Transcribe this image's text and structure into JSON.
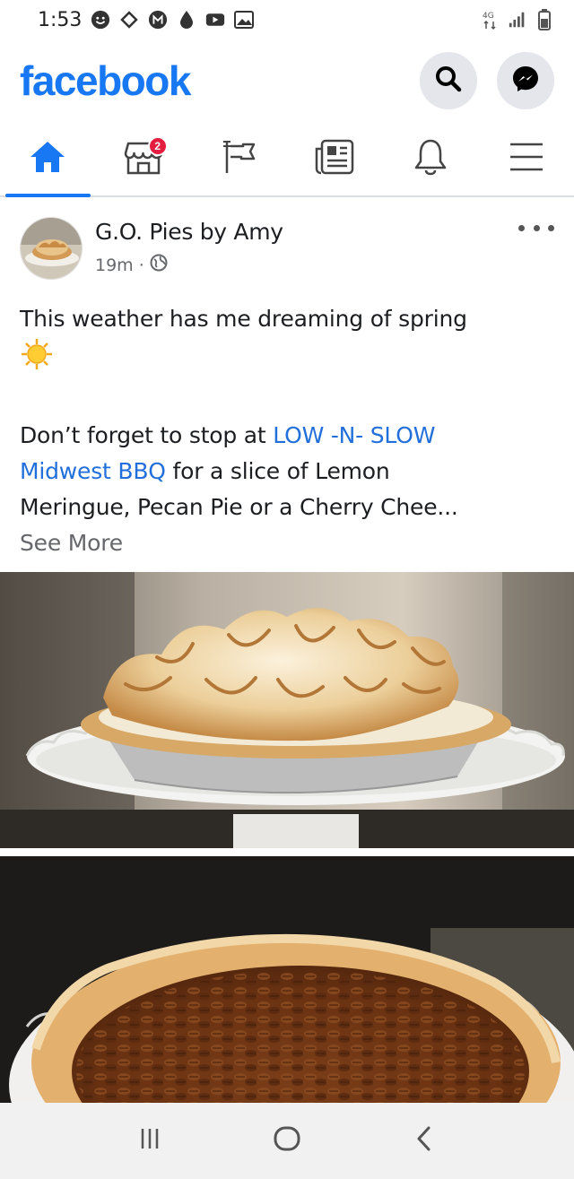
{
  "status_bar": {
    "time": "1:53",
    "left_icons": [
      "smiley-icon",
      "code-diamond-icon",
      "m-app-icon",
      "drop-icon",
      "youtube-icon",
      "image-icon"
    ],
    "right_icons": [
      "4g-icon",
      "signal-icon",
      "battery-icon"
    ]
  },
  "header": {
    "logo": "facebook",
    "brand_color": "#1877f2"
  },
  "nav": {
    "tabs": [
      {
        "name": "home",
        "icon": "home-icon",
        "active": true
      },
      {
        "name": "marketplace",
        "icon": "store-icon",
        "badge": "2"
      },
      {
        "name": "pages",
        "icon": "flag-icon"
      },
      {
        "name": "news",
        "icon": "newspaper-icon"
      },
      {
        "name": "notifications",
        "icon": "bell-icon"
      },
      {
        "name": "menu",
        "icon": "hamburger-icon"
      }
    ]
  },
  "post": {
    "author": "G.O. Pies by Amy",
    "time": "19m",
    "separator": "·",
    "privacy_icon": "globe-icon",
    "line1": "This weather has me dreaming of spring",
    "emoji": "sun-emoji",
    "line2_prefix": "Don’t forget to stop at ",
    "link1": "LOW -N- SLOW",
    "link2": "Midwest BBQ",
    "line3_suffix": " for a slice of Lemon",
    "line4": "Meringue, Pecan Pie or a Cherry Chee...",
    "see_more": "See More"
  },
  "system_nav": {
    "buttons": [
      "recents-icon",
      "home-circle-icon",
      "back-icon"
    ]
  }
}
